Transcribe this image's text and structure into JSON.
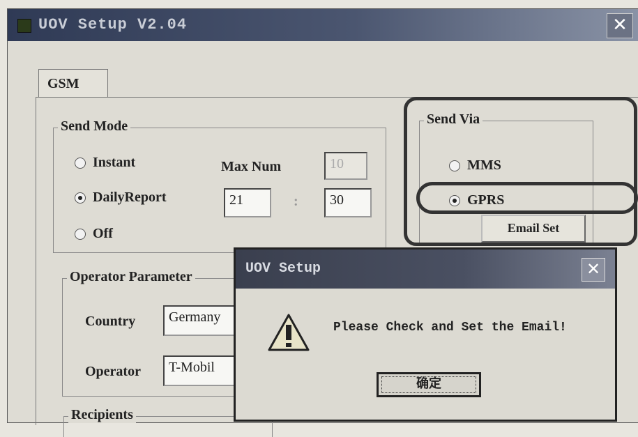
{
  "window": {
    "title": "UOV Setup V2.04",
    "close_symbol": "✕"
  },
  "tabs": [
    {
      "label": "GSM"
    }
  ],
  "send_mode": {
    "legend": "Send Mode",
    "options": [
      {
        "label": "Instant",
        "checked": false
      },
      {
        "label": "DailyReport",
        "checked": true
      },
      {
        "label": "Off",
        "checked": false
      }
    ],
    "max_num_label": "Max Num",
    "max_num_value": "10",
    "hour": "21",
    "separator": ":",
    "minute": "30"
  },
  "send_via": {
    "legend": "Send Via",
    "options": [
      {
        "label": "MMS",
        "checked": false
      },
      {
        "label": "GPRS",
        "checked": true
      }
    ],
    "email_set_label": "Email Set"
  },
  "operator_parameter": {
    "legend": "Operator Parameter",
    "country_label": "Country",
    "country_value": "Germany",
    "operator_label": "Operator",
    "operator_value": "T-Mobil"
  },
  "recipients": {
    "legend": "Recipients"
  },
  "dialog": {
    "title": "UOV Setup",
    "close_symbol": "✕",
    "message": "Please Check and Set the Email!",
    "ok_label": "确定"
  }
}
